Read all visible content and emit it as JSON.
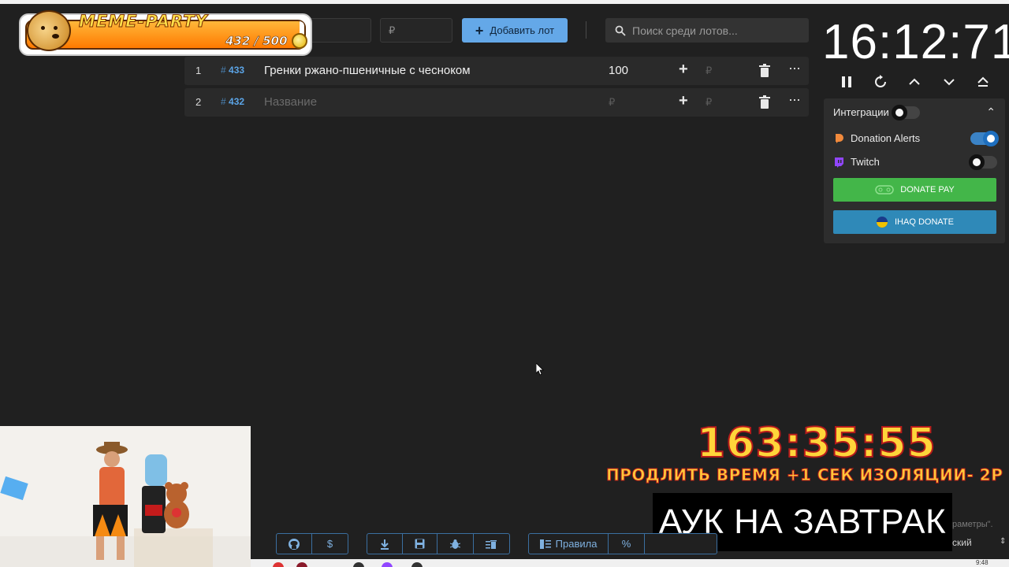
{
  "header": {
    "input1_value": "",
    "price_placeholder": "₽",
    "add_button_label": "Добавить лот",
    "search_placeholder": "Поиск среди лотов..."
  },
  "overlay_badge": {
    "title": "MEME-PARTY",
    "count": "432 / 500"
  },
  "lots": [
    {
      "index": "1",
      "hash": "#",
      "id": "433",
      "name": "Гренки ржано-пшеничные с чесноком",
      "amount": "100",
      "plus": "+",
      "currency": "₽",
      "more": "···"
    },
    {
      "index": "2",
      "hash": "#",
      "id": "432",
      "name": "Название",
      "amount": "₽",
      "plus": "+",
      "currency": "₽",
      "more": "···"
    }
  ],
  "timer": {
    "value": "16:12:71"
  },
  "controls": [
    {
      "icon": "pause-icon",
      "glyph": "❚❚"
    },
    {
      "icon": "restart-icon",
      "glyph": "↻"
    },
    {
      "icon": "chevron-up-icon",
      "glyph": "⌃"
    },
    {
      "icon": "chevron-down-icon",
      "glyph": "⌄"
    },
    {
      "icon": "eject-icon",
      "glyph": "⏏"
    }
  ],
  "integrations": {
    "header_label": "Интеграции",
    "collapse_glyph": "⌃",
    "donation_alerts_label": "Donation Alerts",
    "twitch_label": "Twitch",
    "donate_pay_label": "DONATE PAY",
    "ihaq_label": "IHAQ DONATE",
    "donation_alerts_on": true,
    "twitch_on": false,
    "integrations_on": false,
    "donate_pay_color": "#43b649",
    "ihaq_color": "#2f89b8"
  },
  "stream_overlay": {
    "big_timer": "163:35:55",
    "extend_text": "ПРОДЛИТЬ ВРЕМЯ +1 СЕК ИЗОЛЯЦИИ- 2Р",
    "title_box": "АУК НА ЗАВТРАК"
  },
  "toolbar": {
    "rules_label": "Правила",
    "percent_glyph": "%",
    "dollar_glyph": "$"
  },
  "footer": {
    "params_fragment": "раметры\".",
    "language_fragment": "ский",
    "clock": "9:48"
  }
}
